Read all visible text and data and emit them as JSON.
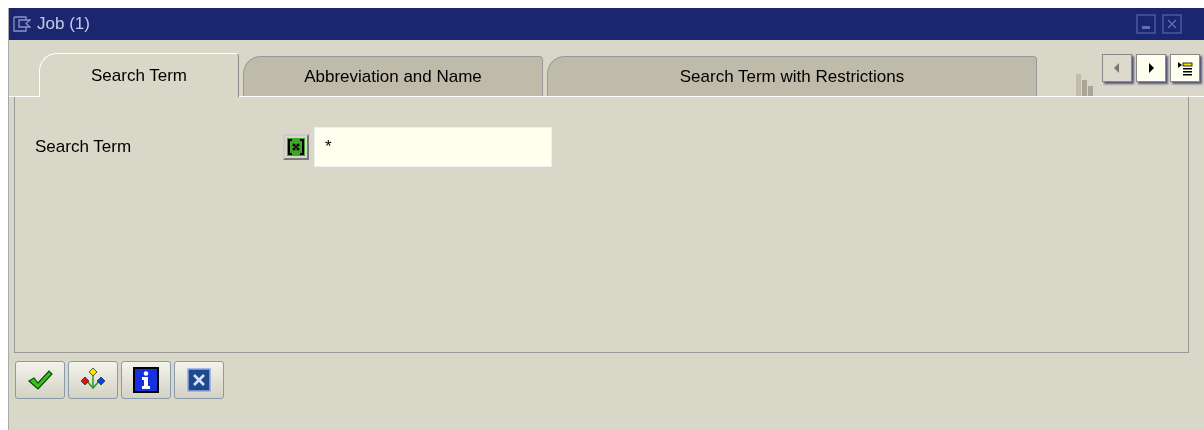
{
  "window": {
    "title": "Job (1)"
  },
  "tabs": [
    {
      "label": "Search Term",
      "selected": true
    },
    {
      "label": "Abbreviation and Name",
      "selected": false
    },
    {
      "label": "Search Term with Restrictions",
      "selected": false
    }
  ],
  "fields": [
    {
      "label": "Search Term",
      "value": "*"
    }
  ],
  "buttons": [
    {
      "kind": "check"
    },
    {
      "kind": "hierarchy"
    },
    {
      "kind": "info"
    },
    {
      "kind": "cancel"
    }
  ]
}
